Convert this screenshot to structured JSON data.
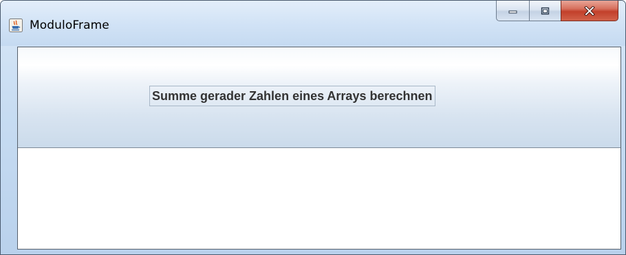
{
  "window": {
    "title": "ModuloFrame",
    "app_icon": "java-icon",
    "caption_buttons": [
      "minimize-icon",
      "maximize-icon",
      "close-icon"
    ]
  },
  "header": {
    "label": "Summe gerader Zahlen eines Arrays berechnen"
  },
  "colors": {
    "titlebar": "#c7dcf2",
    "close_button": "#c2402b",
    "label_text": "#333333",
    "content_background": "#ffffff"
  }
}
